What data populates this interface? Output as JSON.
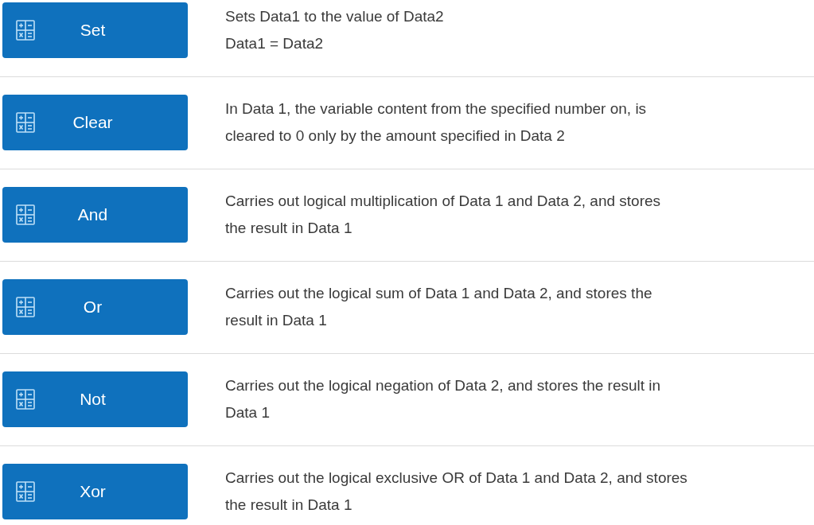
{
  "instructions": [
    {
      "label": "Set",
      "description": "Sets Data1 to the value of Data2\nData1 = Data2"
    },
    {
      "label": "Clear",
      "description": "In Data 1, the variable content from the specified number on, is\ncleared to 0 only by the amount specified in Data 2"
    },
    {
      "label": "And",
      "description": "Carries out logical multiplication of Data 1 and Data 2, and stores\nthe result in Data 1"
    },
    {
      "label": "Or",
      "description": "Carries out the logical sum of Data 1 and Data 2, and stores the\nresult in Data 1"
    },
    {
      "label": "Not",
      "description": "Carries out the logical negation of Data 2, and stores the result in\nData 1"
    },
    {
      "label": "Xor",
      "description": "Carries out the logical exclusive OR of Data 1 and Data 2, and stores\nthe result in Data 1"
    }
  ]
}
